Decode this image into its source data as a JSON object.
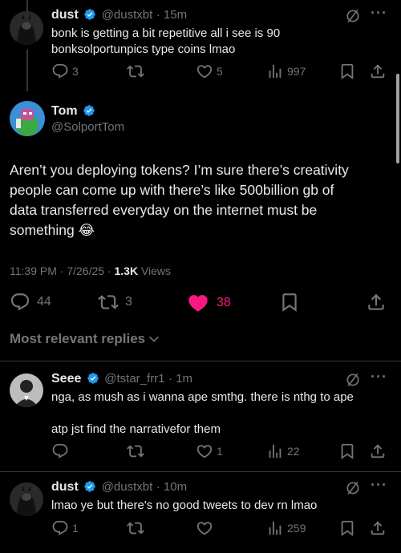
{
  "thread_top": {
    "name": "dust",
    "handle": "@dustxbt",
    "time": "· 15m",
    "text_line1": "bonk is getting a bit repetitive all i see is 90",
    "text_line2": "bonksolportunpics type coins lmao",
    "replies": "3",
    "likes": "5",
    "views": "997"
  },
  "main_tweet": {
    "name": "Tom",
    "handle": "@SolportTom",
    "line1": "Aren’t you deploying tokens? I’m sure there’s creativity",
    "line2": "people can come up with there’s like 500billion gb of",
    "line3": "data transferred everyday on the internet must be",
    "line4": "something 😂",
    "meta_time": "11:39 PM · 7/26/25 · ",
    "meta_views_count": "1.3K",
    "meta_views_label": " Views",
    "replies": "44",
    "retweets": "3",
    "likes": "38"
  },
  "replies_header": "Most relevant replies",
  "reply1": {
    "name": "Seee",
    "handle": "@tstar_frr1",
    "time": "· 1m",
    "line1": "nga, as mush as i wanna ape smthg. there is nthg to ape",
    "line2": "atp jst find the narrativefor them",
    "likes": "1",
    "views": "22"
  },
  "reply2": {
    "name": "dust",
    "handle": "@dustxbt",
    "time": "· 10m",
    "line1": "lmao ye but there's no good tweets to dev rn lmao",
    "replies": "1",
    "views": "259"
  },
  "colors": {
    "like_active": "#f91880",
    "verified": "#1d9bf0",
    "muted": "#71767b"
  },
  "icons": [
    "reply-icon",
    "retweet-icon",
    "like-icon",
    "views-icon",
    "bookmark-icon",
    "share-icon",
    "grok-icon",
    "more-icon",
    "verified-icon",
    "chevron-down-icon"
  ]
}
